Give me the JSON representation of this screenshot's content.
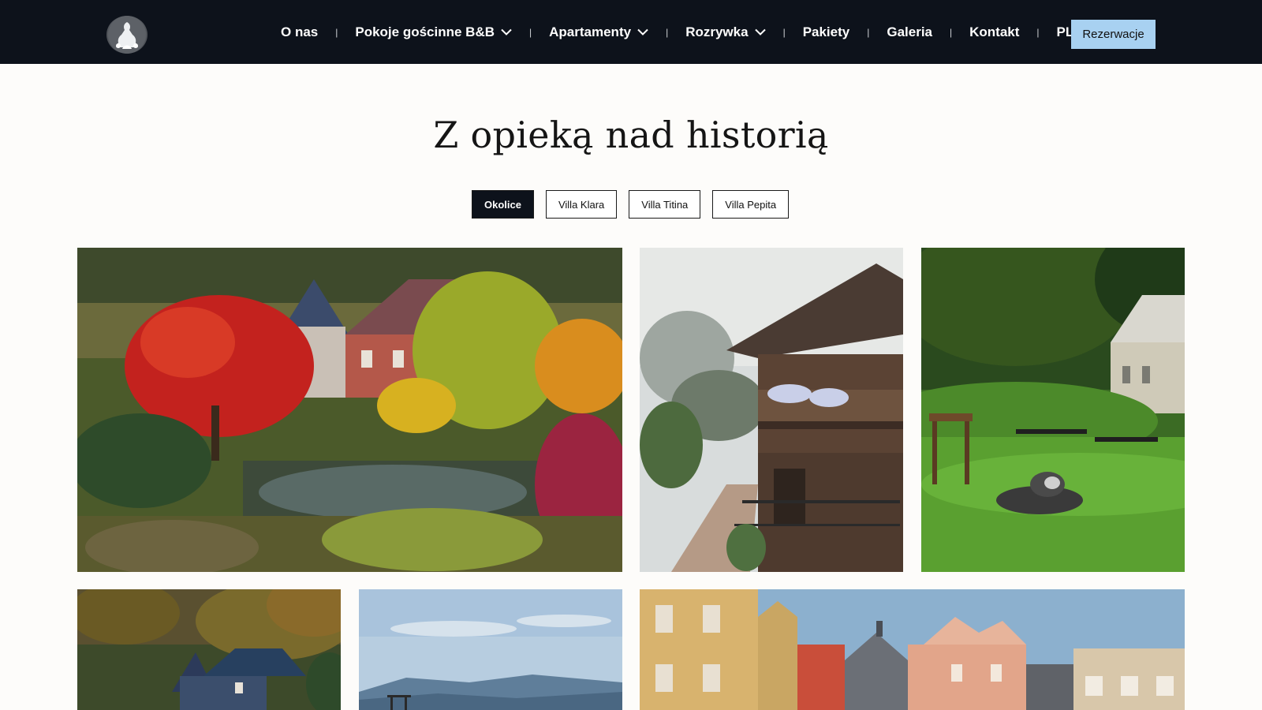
{
  "nav": {
    "logo_icon": "villa-logo-icon",
    "items": [
      {
        "label": "O nas",
        "dropdown": false
      },
      {
        "label": "Pokoje gościnne B&B",
        "dropdown": true
      },
      {
        "label": "Apartamenty",
        "dropdown": true
      },
      {
        "label": "Rozrywka",
        "dropdown": true
      },
      {
        "label": "Pakiety",
        "dropdown": false
      },
      {
        "label": "Galeria",
        "dropdown": false
      },
      {
        "label": "Kontakt",
        "dropdown": false
      },
      {
        "label": "PL",
        "dropdown": true
      }
    ],
    "cta_label": "Rezerwacje"
  },
  "hero": {
    "title": "Z opieką nad historią"
  },
  "filters": {
    "items": [
      "Okolice",
      "Villa Klara",
      "Villa Titina",
      "Villa Pepita"
    ],
    "active": "Okolice"
  },
  "colors": {
    "nav_bg": "#0d121b",
    "accent": "#a8d1f1",
    "page_bg": "#fdfcfa"
  }
}
